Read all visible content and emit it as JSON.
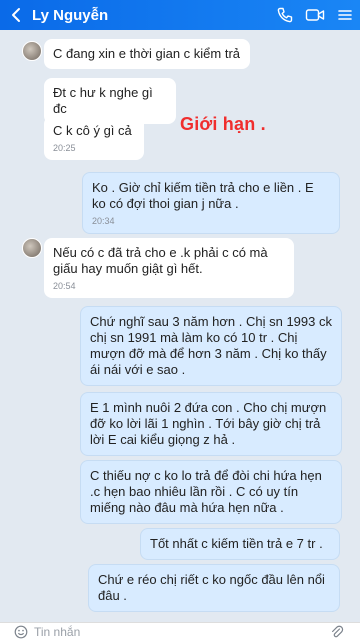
{
  "header": {
    "contact_name": "Ly Nguyễn"
  },
  "annotation": "Giới hạn .",
  "messages": [
    {
      "text": "C đang xin e thời gian c kiểm trả",
      "time": ""
    },
    {
      "text": "Đt c hư k nghe gì đc",
      "time": ""
    },
    {
      "text": "C k cô ý gì cả",
      "time": "20:25"
    },
    {
      "text": "Ko . Giờ chỉ kiếm tiền trả cho e liền . E ko có đợi thoi gian j nữa .",
      "time": "20:34"
    },
    {
      "text": "Nếu có c đã trả cho e .k phải c có mà giấu hay muốn giật gì hết.",
      "time": "20:54"
    },
    {
      "text": "Chứ nghĩ sau 3 năm hơn . Chị sn 1993 ck chị sn 1991 mà làm ko có 10 tr . Chị mượn đỡ mà để hơn 3 năm . Chị ko thấy ái nái với e sao .",
      "time": ""
    },
    {
      "text": "E 1 mình nuôi 2 đứa con . Cho chị mượn đỡ ko lời lãi 1 nghìn . Tới bây giờ chị trả lời E cai kiểu giọng z hả .",
      "time": ""
    },
    {
      "text": "C thiếu nợ c ko lo trả để đòi chi hứa hẹn .c hẹn bao nhiêu lần rồi . C có uy tín miếng nào đâu mà hứa hẹn nữa .",
      "time": ""
    },
    {
      "text": "Tốt nhất c kiếm tiền trả e 7 tr .",
      "time": ""
    },
    {
      "text": "Chứ e réo chị riết c ko ngốc đầu lên nổi đâu .",
      "time": ""
    }
  ],
  "composer": {
    "placeholder": "Tin nhắn"
  },
  "icons": {
    "back": "chevron-left-icon",
    "call": "phone-icon",
    "video": "video-icon",
    "menu": "menu-icon",
    "emoji": "emoji-icon",
    "attach": "attachment-icon"
  },
  "colors": {
    "header": "#0a6ae8",
    "background": "#e2e9f1",
    "incoming": "#ffffff",
    "outgoing": "#d8ebff",
    "annotation": "#f02e2e"
  }
}
